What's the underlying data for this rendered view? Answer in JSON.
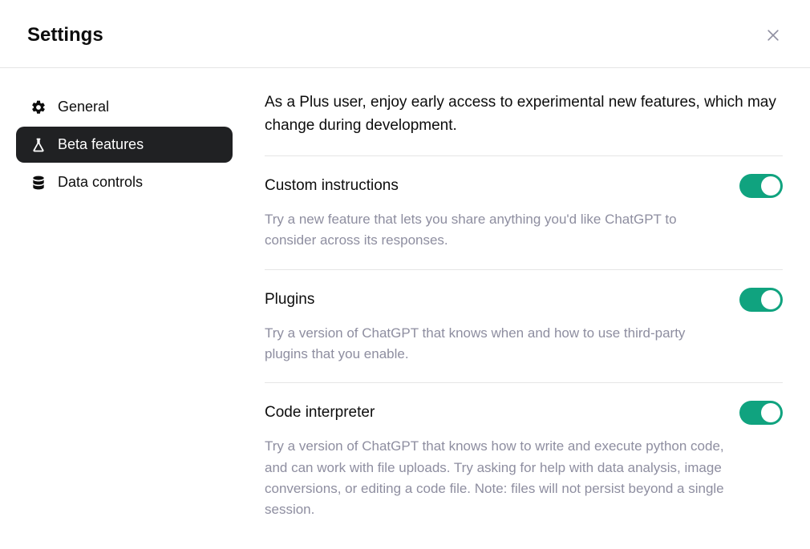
{
  "header": {
    "title": "Settings"
  },
  "sidebar": {
    "items": [
      {
        "label": "General",
        "icon": "gear",
        "active": false
      },
      {
        "label": "Beta features",
        "icon": "flask",
        "active": true
      },
      {
        "label": "Data controls",
        "icon": "database",
        "active": false
      }
    ]
  },
  "content": {
    "intro": "As a Plus user, enjoy early access to experimental new features, which may change during development.",
    "sections": [
      {
        "title": "Custom instructions",
        "description": "Try a new feature that lets you share anything you'd like ChatGPT to consider across its responses.",
        "enabled": true
      },
      {
        "title": "Plugins",
        "description": "Try a version of ChatGPT that knows when and how to use third-party plugins that you enable.",
        "enabled": true
      },
      {
        "title": "Code interpreter",
        "description": "Try a version of ChatGPT that knows how to write and execute python code, and can work with file uploads. Try asking for help with data analysis, image conversions, or editing a code file. Note: files will not persist beyond a single session.",
        "enabled": true
      }
    ]
  },
  "colors": {
    "toggle_on": "#10a37f",
    "active_bg": "#202123"
  }
}
